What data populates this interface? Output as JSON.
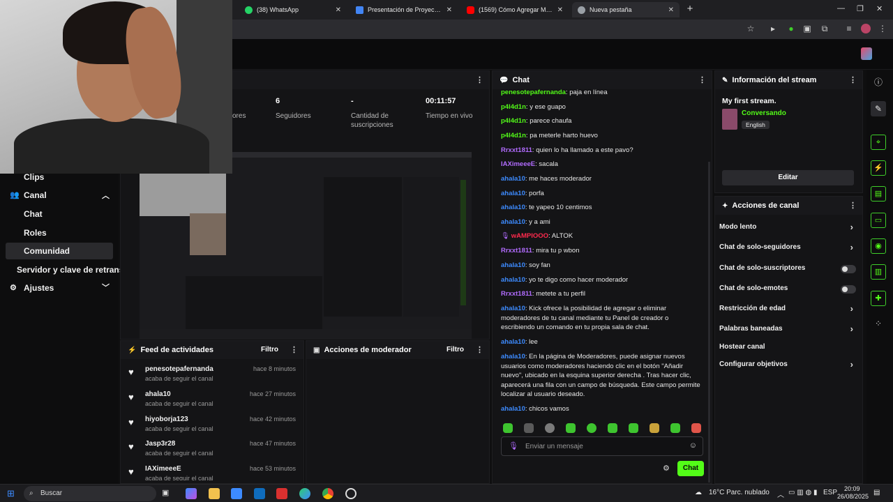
{
  "browser": {
    "tabs": [
      {
        "label": "(38) WhatsApp",
        "favicon_color": "#25d366"
      },
      {
        "label": "Presentación de Proyecto de Em",
        "favicon_color": "#4285f4"
      },
      {
        "label": "(1569) Cómo Agregar Moderad",
        "favicon_color": "#ff0000"
      },
      {
        "label": "Nueva pestaña",
        "favicon_color": "#9aa0a6"
      }
    ],
    "new_tab": "+"
  },
  "sidebar": {
    "clips": "Clips",
    "canal": "Canal",
    "chat": "Chat",
    "roles": "Roles",
    "comunidad": "Comunidad",
    "servidor": "Servidor y clave de retrans",
    "ajustes": "Ajustes"
  },
  "stats": {
    "seguidores_value": "6",
    "seguidores_label": "Seguidores",
    "suscripciones_value": "-",
    "suscripciones_label_1": "Cantidad de",
    "suscripciones_label_2": "suscripciones",
    "tiempo_value": "00:11:57",
    "tiempo_label": "Tiempo en vivo",
    "partial_label": "ores"
  },
  "feed": {
    "title": "Feed de actividades",
    "filter": "Filtro",
    "items": [
      {
        "name": "penesotepafernanda",
        "action": "acaba de seguir el canal",
        "time": "hace 8 minutos"
      },
      {
        "name": "ahala10",
        "action": "acaba de seguir el canal",
        "time": "hace 27 minutos"
      },
      {
        "name": "hiyoborja123",
        "action": "acaba de seguir el canal",
        "time": "hace 42 minutos"
      },
      {
        "name": "Jasp3r28",
        "action": "acaba de seguir el canal",
        "time": "hace 47 minutos"
      },
      {
        "name": "IAXimeeeE",
        "action": "acaba de seguir el canal",
        "time": "hace 53 minutos"
      }
    ]
  },
  "moderator": {
    "title": "Acciones de moderador",
    "filter": "Filtro"
  },
  "chat": {
    "title": "Chat",
    "messages": [
      {
        "user": "penesotepafernanda",
        "color": "#53fc18",
        "text": "paja en línea"
      },
      {
        "user": "p4l4d1n",
        "color": "#53fc18",
        "text": "y ese guapo"
      },
      {
        "user": "p4l4d1n",
        "color": "#53fc18",
        "text": "parece chaufa"
      },
      {
        "user": "p4l4d1n",
        "color": "#53fc18",
        "text": "pa meterle harto huevo"
      },
      {
        "user": "Rrxxt1811",
        "color": "#b26cff",
        "text": "quien lo ha llamado a este pavo?"
      },
      {
        "user": "IAXimeeeE",
        "color": "#b26cff",
        "text": "sacala"
      },
      {
        "user": "ahala10",
        "color": "#3d8bff",
        "text": "me haces moderador"
      },
      {
        "user": "ahala10",
        "color": "#3d8bff",
        "text": "porfa"
      },
      {
        "user": "ahala10",
        "color": "#3d8bff",
        "text": "te yapeo 10 centimos"
      },
      {
        "user": "ahala10",
        "color": "#3d8bff",
        "text": "y a ami"
      },
      {
        "user": "wAMPIOOO",
        "color": "#ff2a4d",
        "text": "ALTOK"
      },
      {
        "user": "Rrxxt1811",
        "color": "#b26cff",
        "text": "mira tu p wbon"
      },
      {
        "user": "ahala10",
        "color": "#3d8bff",
        "text": "soy fan"
      },
      {
        "user": "ahala10",
        "color": "#3d8bff",
        "text": "yo te digo como hacer moderador"
      },
      {
        "user": "Rrxxt1811",
        "color": "#b26cff",
        "text": "metete a tu perfil"
      },
      {
        "user": "ahala10",
        "color": "#3d8bff",
        "text": "Kick ofrece la posibilidad de agregar o eliminar moderadores de tu canal mediante tu Panel de creador o escribiendo un comando en tu propia sala de chat."
      },
      {
        "user": "ahala10",
        "color": "#3d8bff",
        "text": "lee"
      },
      {
        "user": "ahala10",
        "color": "#3d8bff",
        "text": "En la página de Moderadores, puede asignar nuevos usuarios como moderadores haciendo clic en el botón \"Añadir nuevo\", ubicado en la esquina superior derecha . Tras hacer clic, aparecerá una fila con un campo de búsqueda. Este campo permite localizar al usuario deseado."
      },
      {
        "user": "ahala10",
        "color": "#3d8bff",
        "text": "chicos vamos"
      }
    ],
    "input_placeholder": "Enviar un mensaje",
    "send_button": "Chat"
  },
  "stream_info": {
    "title": "Información del stream",
    "stream_title": "My first stream.",
    "category": "Conversando",
    "language": "English",
    "edit_button": "Editar"
  },
  "channel_actions": {
    "title": "Acciones de canal",
    "items": [
      {
        "label": "Modo lento",
        "control": "chevron"
      },
      {
        "label": "Chat de solo-seguidores",
        "control": "chevron"
      },
      {
        "label": "Chat de solo-suscriptores",
        "control": "toggle"
      },
      {
        "label": "Chat de solo-emotes",
        "control": "toggle"
      },
      {
        "label": "Restricción de edad",
        "control": "chevron"
      },
      {
        "label": "Palabras baneadas",
        "control": "chevron"
      },
      {
        "label": "Hostear canal",
        "control": "none"
      },
      {
        "label": "Configurar objetivos",
        "control": "chevron"
      }
    ]
  },
  "taskbar": {
    "search": "Buscar",
    "weather": "16°C  Parc. nublado",
    "lang": "ESP",
    "time": "20:09",
    "date": "26/08/2025"
  },
  "colors": {
    "accent": "#53fc18",
    "bg": "#0f0f10",
    "panel": "#141416"
  }
}
